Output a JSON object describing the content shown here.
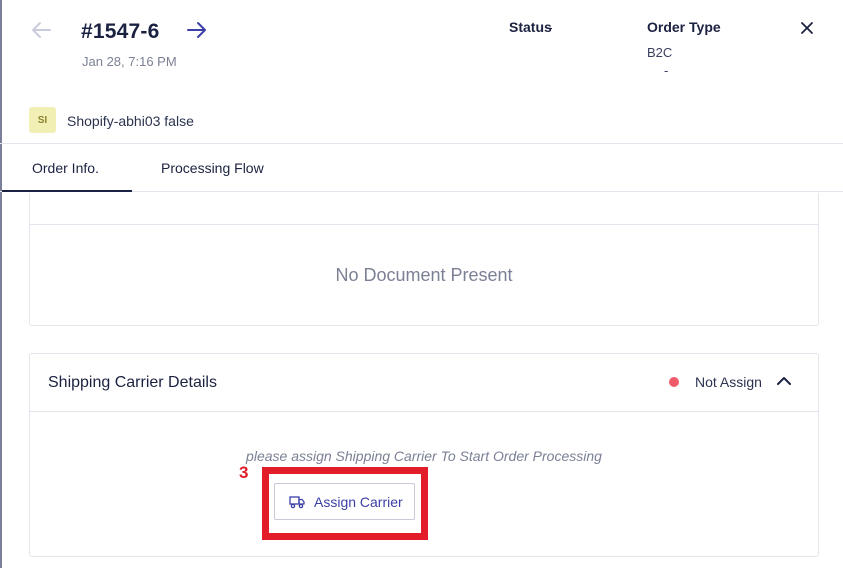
{
  "header": {
    "order_number": "#1547-6",
    "order_date": "Jan 28, 7:16 PM",
    "status_label": "Status",
    "status_value": "-",
    "order_type_label": "Order Type",
    "order_type_value": "B2C",
    "order_type_sub": "-",
    "icons": {
      "back": "arrow-left-icon",
      "next": "arrow-right-icon",
      "close": "close-icon"
    }
  },
  "store": {
    "badge": "SI",
    "name": "Shopify-abhi03 false"
  },
  "tabs": [
    {
      "label": "Order Info.",
      "active": true
    },
    {
      "label": "Processing Flow",
      "active": false
    }
  ],
  "documents": {
    "empty_text": "No Document Present"
  },
  "shipping": {
    "title": "Shipping Carrier Details",
    "status": "Not Assign",
    "status_color": "#ef5b6b",
    "hint": "please assign Shipping Carrier To Start Order Processing",
    "assign_button_label": "Assign Carrier",
    "icons": {
      "collapse": "chevron-up-icon",
      "carrier": "truck-icon"
    }
  },
  "annotation": {
    "step_number": "3",
    "highlight_color": "#e31c2a"
  },
  "colors": {
    "accent": "#3b3fa6",
    "text_dark": "#1b2140",
    "muted": "#7b8094"
  }
}
